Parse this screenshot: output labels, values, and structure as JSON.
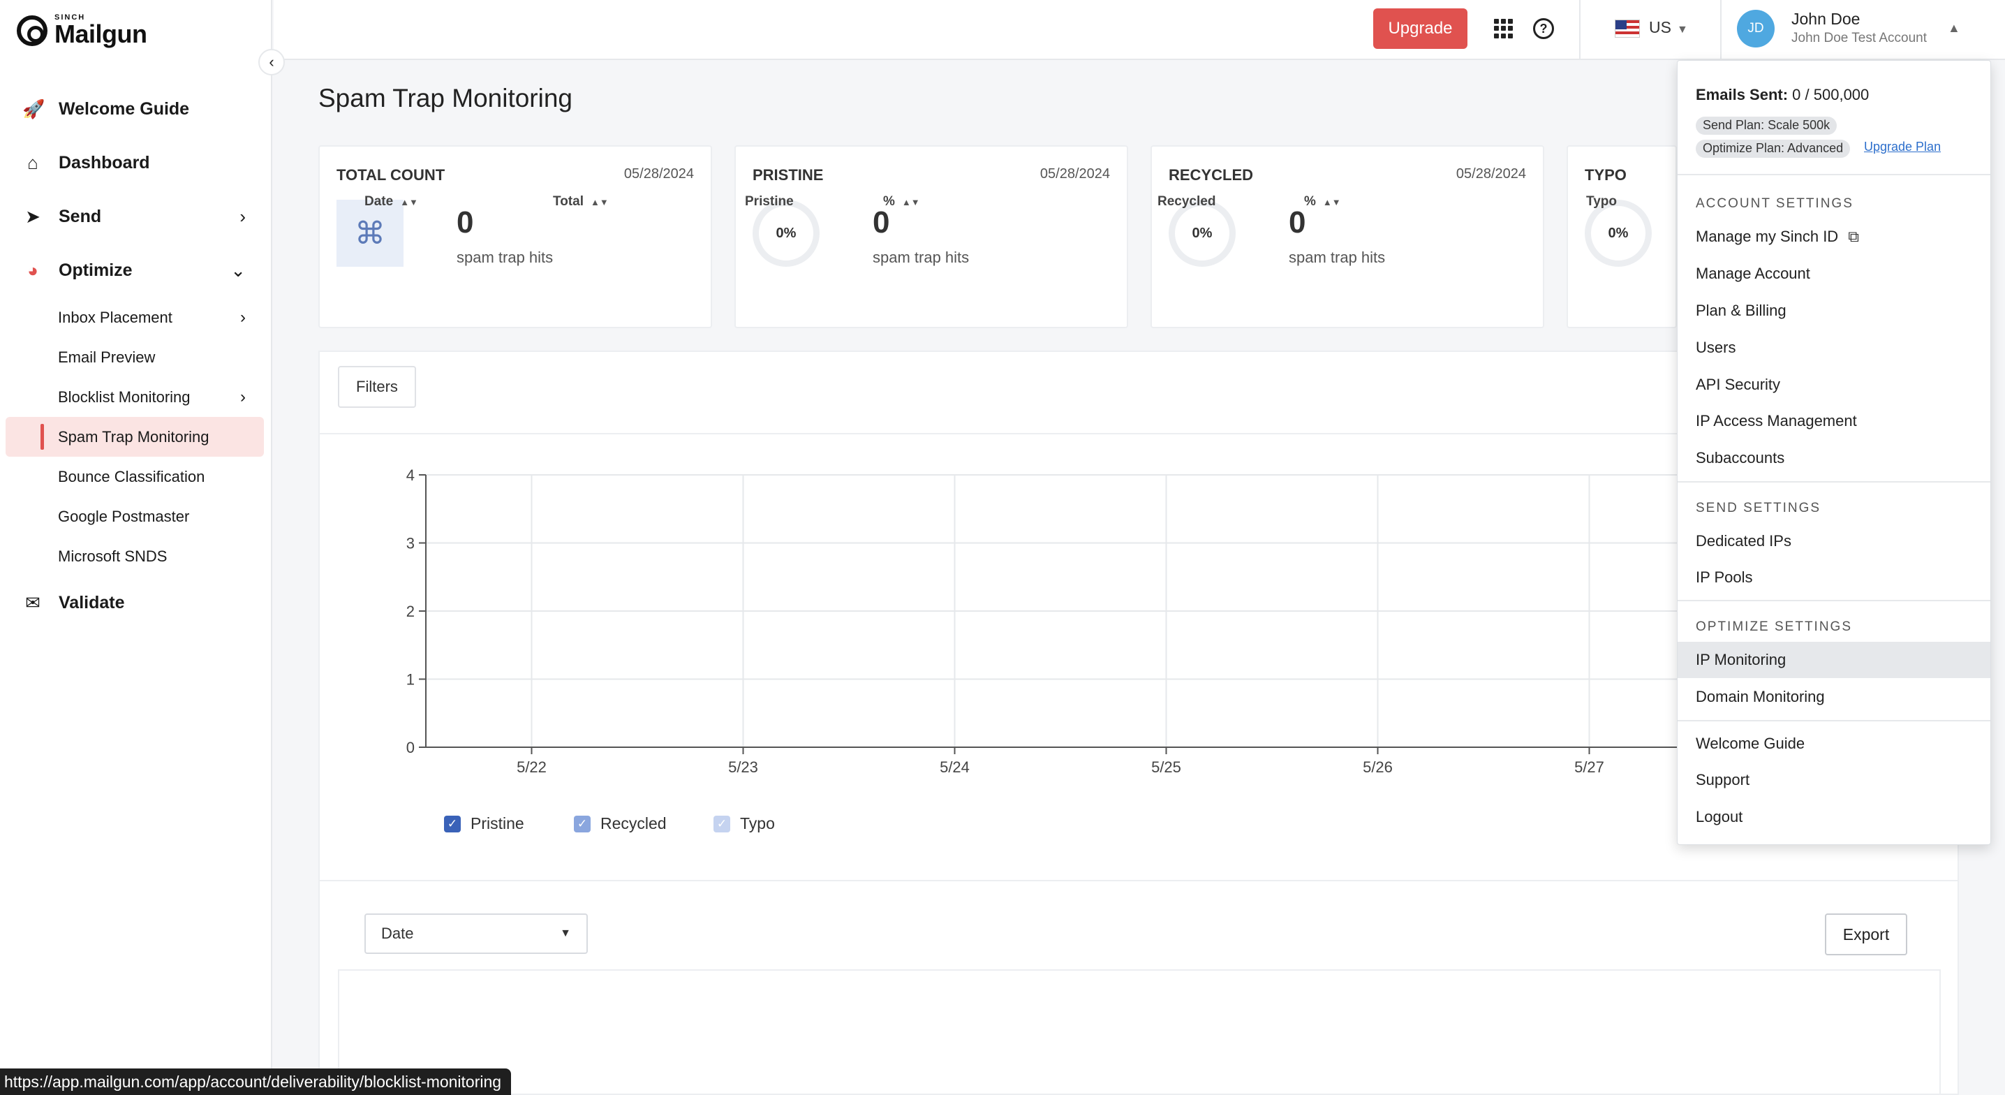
{
  "brand": {
    "sub": "SINCH",
    "name": "Mailgun"
  },
  "sidebar": {
    "items": [
      {
        "label": "Welcome Guide",
        "icon": "rocket-icon"
      },
      {
        "label": "Dashboard",
        "icon": "home-icon"
      },
      {
        "label": "Send",
        "icon": "send-icon"
      },
      {
        "label": "Optimize",
        "icon": "optimize-icon"
      }
    ],
    "optimize_sub": [
      {
        "label": "Inbox Placement"
      },
      {
        "label": "Email Preview"
      },
      {
        "label": "Blocklist Monitoring"
      },
      {
        "label": "Spam Trap Monitoring"
      },
      {
        "label": "Bounce Classification"
      },
      {
        "label": "Google Postmaster"
      },
      {
        "label": "Microsoft SNDS"
      }
    ],
    "validate": {
      "label": "Validate",
      "icon": "validate-icon"
    }
  },
  "topbar": {
    "upgrade_label": "Upgrade",
    "region": "US",
    "avatar_initials": "JD",
    "user_name": "John Doe",
    "user_account": "John Doe Test Account"
  },
  "page": {
    "title": "Spam Trap Monitoring"
  },
  "cards": [
    {
      "title": "TOTAL COUNT",
      "date": "05/28/2024",
      "value": "0",
      "sub": "spam trap hits"
    },
    {
      "title": "PRISTINE",
      "date": "05/28/2024",
      "percent": "0%",
      "value": "0",
      "sub": "spam trap hits"
    },
    {
      "title": "RECYCLED",
      "date": "05/28/2024",
      "percent": "0%",
      "value": "0",
      "sub": "spam trap hits"
    },
    {
      "title": "TYPO",
      "percent": "0%"
    }
  ],
  "filters_label": "Filters",
  "chart_data": {
    "type": "line",
    "x": [
      "5/22",
      "5/23",
      "5/24",
      "5/25",
      "5/26",
      "5/27"
    ],
    "y_ticks": [
      0,
      1,
      2,
      3,
      4
    ],
    "ylim": [
      0,
      4
    ],
    "series": [
      {
        "name": "Pristine",
        "values": [
          0,
          0,
          0,
          0,
          0,
          0
        ],
        "color": "#3a62b8"
      },
      {
        "name": "Recycled",
        "values": [
          0,
          0,
          0,
          0,
          0,
          0
        ],
        "color": "#8aa6de"
      },
      {
        "name": "Typo",
        "values": [
          0,
          0,
          0,
          0,
          0,
          0
        ],
        "color": "#c5d3f0"
      }
    ],
    "grid": true,
    "legend": "bottom-left"
  },
  "table": {
    "group_select": "Date",
    "export_label": "Export",
    "columns": [
      "Date",
      "Total",
      "Pristine",
      "%",
      "Recycled",
      "%",
      "Typo",
      "%"
    ]
  },
  "status_url": "https://app.mailgun.com/app/account/deliverability/blocklist-monitoring",
  "dropdown": {
    "emails_sent_label": "Emails Sent:",
    "emails_sent_value": "0 / 500,000",
    "send_plan": "Send Plan: Scale 500k",
    "optimize_plan": "Optimize Plan: Advanced",
    "upgrade_plan": "Upgrade Plan",
    "account_section": "ACCOUNT SETTINGS",
    "account_items": [
      "Manage my Sinch ID",
      "Manage Account",
      "Plan & Billing",
      "Users",
      "API Security",
      "IP Access Management",
      "Subaccounts"
    ],
    "send_section": "SEND SETTINGS",
    "send_items": [
      "Dedicated IPs",
      "IP Pools"
    ],
    "optimize_section": "OPTIMIZE SETTINGS",
    "optimize_items": [
      "IP Monitoring",
      "Domain Monitoring"
    ],
    "other_items": [
      "Welcome Guide",
      "Support",
      "Logout"
    ]
  },
  "colors": {
    "accent": "#e0524f",
    "link": "#2d6fcc",
    "avatar": "#4fa8e0"
  }
}
